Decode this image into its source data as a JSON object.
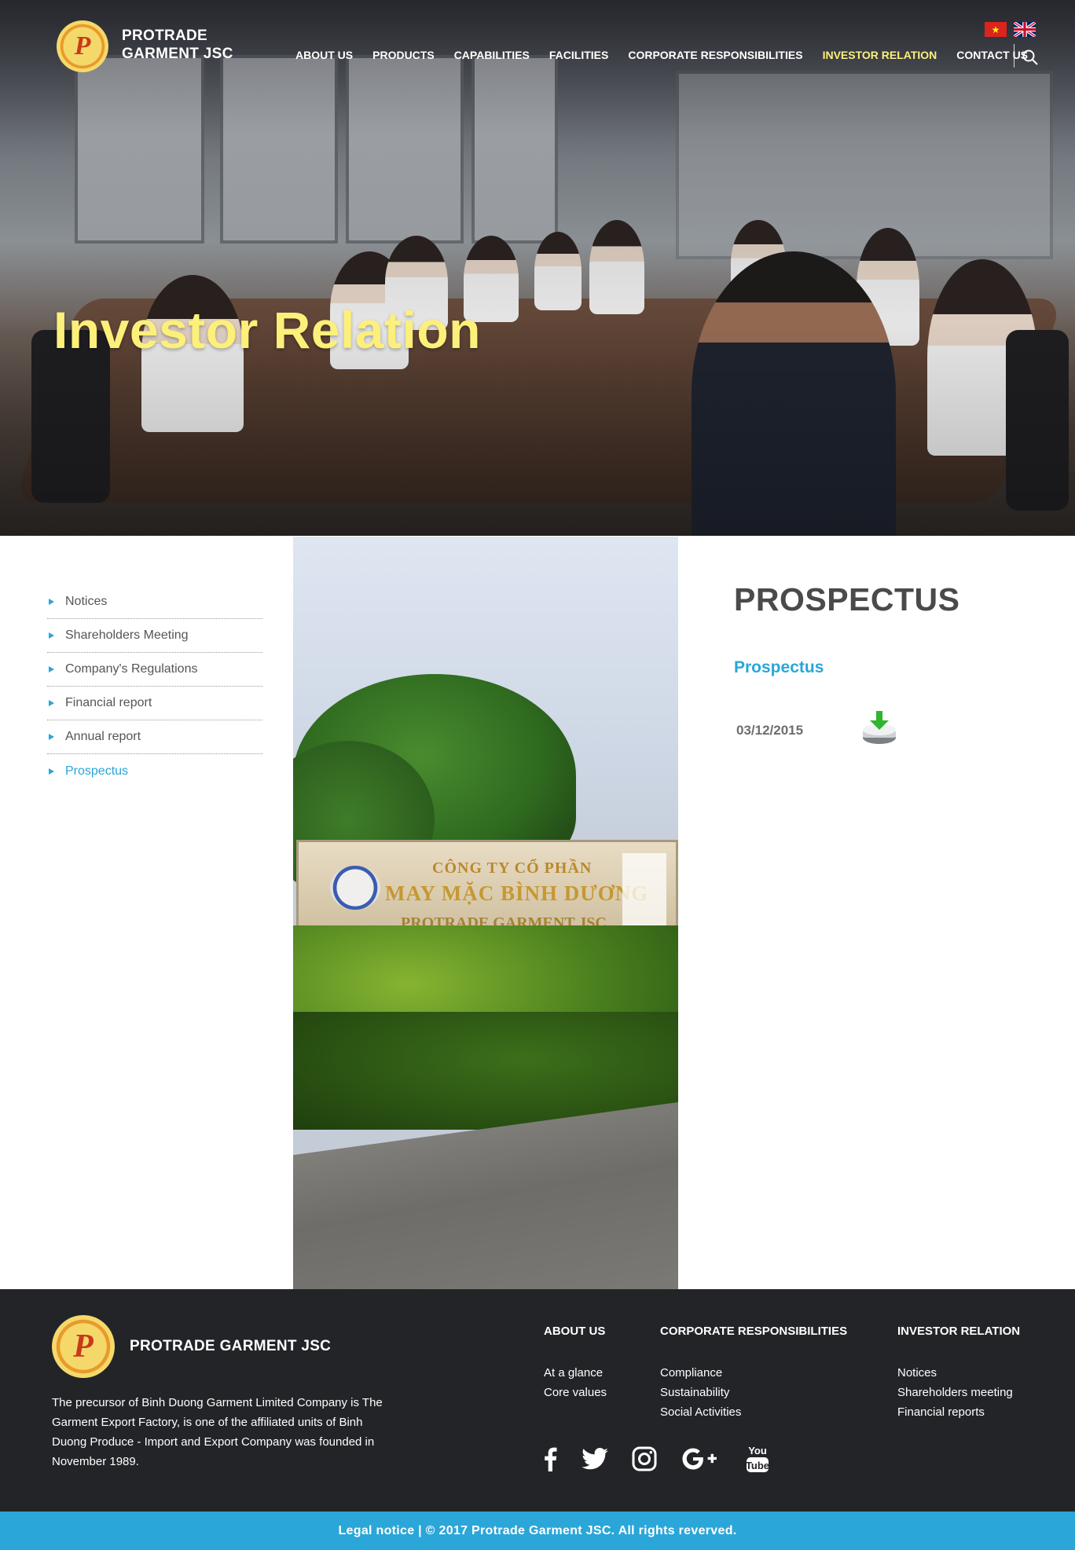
{
  "header": {
    "brand_line1": "PROTRADE",
    "brand_line2": "GARMENT JSC",
    "logo_letter": "P",
    "nav": [
      {
        "label": "ABOUT US"
      },
      {
        "label": "PRODUCTS"
      },
      {
        "label": "CAPABILITIES"
      },
      {
        "label": "FACILITIES"
      },
      {
        "label": "CORPORATE RESPONSIBILITIES"
      },
      {
        "label": "INVESTOR RELATION",
        "active": true
      },
      {
        "label": "CONTACT US"
      }
    ],
    "active_nav_color": "#fdf07a"
  },
  "hero": {
    "title": "Investor Relation"
  },
  "sidebar": {
    "items": [
      {
        "label": "Notices"
      },
      {
        "label": "Shareholders Meeting"
      },
      {
        "label": "Company's Regulations"
      },
      {
        "label": "Financial report"
      },
      {
        "label": "Annual report"
      },
      {
        "label": "Prospectus",
        "active": true
      }
    ]
  },
  "photo_sign": {
    "line1": "CÔNG TY CỔ PHẦN",
    "line2": "MAY MẶC BÌNH DƯƠNG",
    "line3": "PROTRADE GARMENT JSC"
  },
  "content": {
    "title": "PROSPECTUS",
    "subtitle": "Prospectus",
    "document_date": "03/12/2015",
    "download_icon": "download-icon"
  },
  "footer": {
    "brand": "PROTRADE GARMENT JSC",
    "description": "The precursor of Binh Duong Garment Limited Company is The Garment Export Factory, is one of the affiliated units of Binh Duong Produce - Import and Export Company was founded in November 1989.",
    "columns": [
      {
        "heading": "ABOUT US",
        "links": [
          "At a glance",
          "Core values"
        ]
      },
      {
        "heading": "CORPORATE RESPONSIBILITIES",
        "links": [
          "Compliance",
          "Sustainability",
          "Social Activities"
        ]
      },
      {
        "heading": "INVESTOR RELATION",
        "links": [
          "Notices",
          "Shareholders meeting",
          "Financial reports"
        ]
      }
    ],
    "social": [
      "facebook-icon",
      "twitter-icon",
      "instagram-icon",
      "google-plus-icon",
      "youtube-icon"
    ],
    "bottom_text": "Legal notice | © 2017 Protrade Garment JSC. All rights reverved."
  },
  "colors": {
    "accent": "#2aa6d9",
    "footer_bg": "#232428",
    "hero_title": "#fdf07a"
  }
}
